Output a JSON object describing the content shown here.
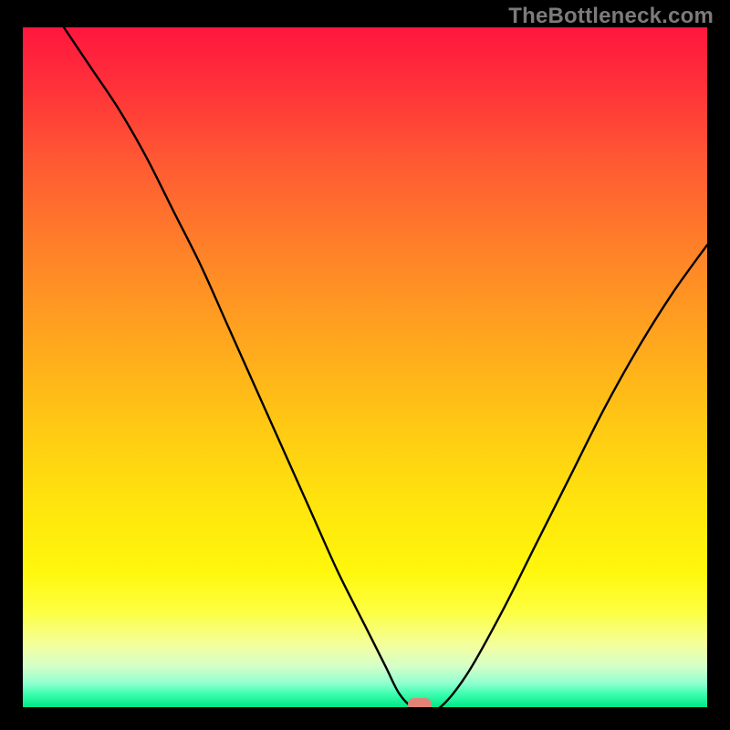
{
  "watermark": "TheBottleneck.com",
  "colors": {
    "curve": "#000000",
    "marker": "#e38377",
    "frame": "#000000"
  },
  "chart_data": {
    "type": "line",
    "title": "",
    "xlabel": "",
    "ylabel": "",
    "xlim": [
      0,
      100
    ],
    "ylim": [
      0,
      100
    ],
    "x": [
      6,
      10,
      14,
      18,
      22,
      26,
      30,
      34,
      38,
      42,
      46,
      50,
      53,
      55,
      57,
      59,
      61,
      65,
      70,
      75,
      80,
      85,
      90,
      95,
      100
    ],
    "values": [
      100,
      94,
      88,
      81,
      73,
      65,
      56,
      47,
      38,
      29,
      20,
      12,
      6,
      2,
      0,
      0,
      0,
      5,
      14,
      24,
      34,
      44,
      53,
      61,
      68
    ],
    "optimum_x": 58,
    "optimum_y": 0,
    "flat_bottom_x_range": [
      55,
      60
    ]
  }
}
